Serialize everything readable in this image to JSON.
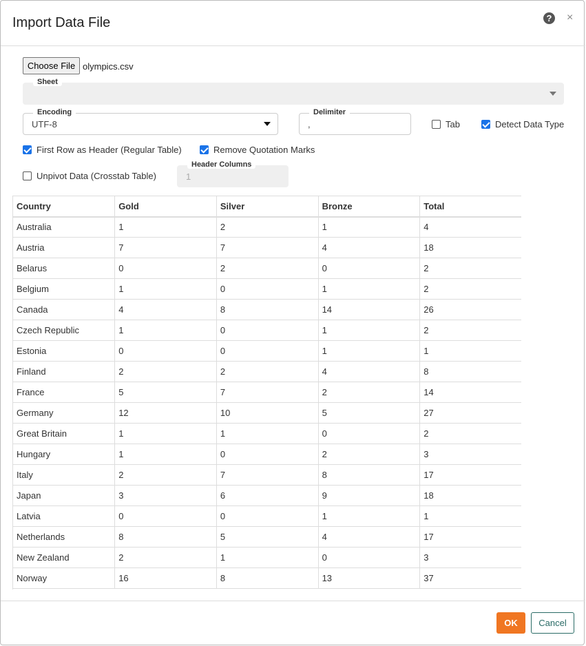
{
  "dialog": {
    "title": "Import Data File",
    "help_icon": "?",
    "close_icon": "×"
  },
  "file": {
    "button": "Choose File",
    "name": "olympics.csv"
  },
  "sheet": {
    "label": "Sheet",
    "value": ""
  },
  "encoding": {
    "label": "Encoding",
    "value": "UTF-8"
  },
  "delimiter": {
    "label": "Delimiter",
    "value": ","
  },
  "options": {
    "tab": {
      "label": "Tab",
      "checked": false
    },
    "detect": {
      "label": "Detect Data Type",
      "checked": true
    },
    "first_row": {
      "label": "First Row as Header (Regular Table)",
      "checked": true
    },
    "remove_quotes": {
      "label": "Remove Quotation Marks",
      "checked": true
    },
    "unpivot": {
      "label": "Unpivot Data (Crosstab Table)",
      "checked": false
    }
  },
  "header_columns": {
    "label": "Header Columns",
    "placeholder": "1"
  },
  "table": {
    "columns": [
      "Country",
      "Gold",
      "Silver",
      "Bronze",
      "Total"
    ],
    "rows": [
      [
        "Australia",
        "1",
        "2",
        "1",
        "4"
      ],
      [
        "Austria",
        "7",
        "7",
        "4",
        "18"
      ],
      [
        "Belarus",
        "0",
        "2",
        "0",
        "2"
      ],
      [
        "Belgium",
        "1",
        "0",
        "1",
        "2"
      ],
      [
        "Canada",
        "4",
        "8",
        "14",
        "26"
      ],
      [
        "Czech Republic",
        "1",
        "0",
        "1",
        "2"
      ],
      [
        "Estonia",
        "0",
        "0",
        "1",
        "1"
      ],
      [
        "Finland",
        "2",
        "2",
        "4",
        "8"
      ],
      [
        "France",
        "5",
        "7",
        "2",
        "14"
      ],
      [
        "Germany",
        "12",
        "10",
        "5",
        "27"
      ],
      [
        "Great Britain",
        "1",
        "1",
        "0",
        "2"
      ],
      [
        "Hungary",
        "1",
        "0",
        "2",
        "3"
      ],
      [
        "Italy",
        "2",
        "7",
        "8",
        "17"
      ],
      [
        "Japan",
        "3",
        "6",
        "9",
        "18"
      ],
      [
        "Latvia",
        "0",
        "0",
        "1",
        "1"
      ],
      [
        "Netherlands",
        "8",
        "5",
        "4",
        "17"
      ],
      [
        "New Zealand",
        "2",
        "1",
        "0",
        "3"
      ],
      [
        "Norway",
        "16",
        "8",
        "13",
        "37"
      ]
    ]
  },
  "footer": {
    "ok": "OK",
    "cancel": "Cancel"
  },
  "colors": {
    "accent": "#f07622",
    "cancel": "#2a6b66",
    "checkbox": "#1a73e8"
  }
}
